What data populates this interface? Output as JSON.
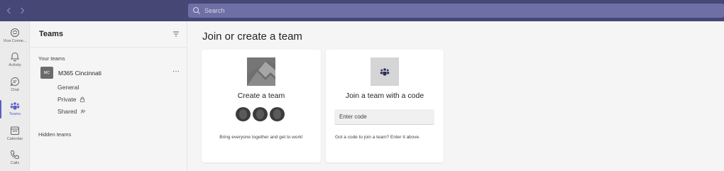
{
  "topbar": {
    "search_placeholder": "Search"
  },
  "rail": {
    "items": [
      {
        "label": "Viva Conne...",
        "icon": "viva-connections-icon"
      },
      {
        "label": "Activity",
        "icon": "bell-icon"
      },
      {
        "label": "Chat",
        "icon": "chat-icon"
      },
      {
        "label": "Teams",
        "icon": "teams-icon",
        "active": true
      },
      {
        "label": "Calendar",
        "icon": "calendar-icon"
      },
      {
        "label": "Calls",
        "icon": "phone-icon"
      }
    ]
  },
  "panel": {
    "title": "Teams",
    "your_teams_label": "Your teams",
    "team": {
      "avatar_initials": "MC",
      "name": "M365 Cincinnati",
      "more": "···",
      "channels": [
        {
          "name": "General"
        },
        {
          "name": "Private",
          "icon": "lock-icon"
        },
        {
          "name": "Shared",
          "icon": "shared-icon"
        }
      ]
    },
    "hidden_teams_label": "Hidden teams"
  },
  "main": {
    "title": "Join or create a team",
    "create_card": {
      "title": "Create a team",
      "footer": "Bring everyone together and get to work!"
    },
    "join_card": {
      "title": "Join a team with a code",
      "input_placeholder": "Enter code",
      "footer": "Got a code to join a team? Enter it above."
    }
  },
  "colors": {
    "topbar": "#464775",
    "accent": "#5b5fc7",
    "rail_bg": "#ebebeb",
    "content_bg": "#f5f5f5"
  }
}
